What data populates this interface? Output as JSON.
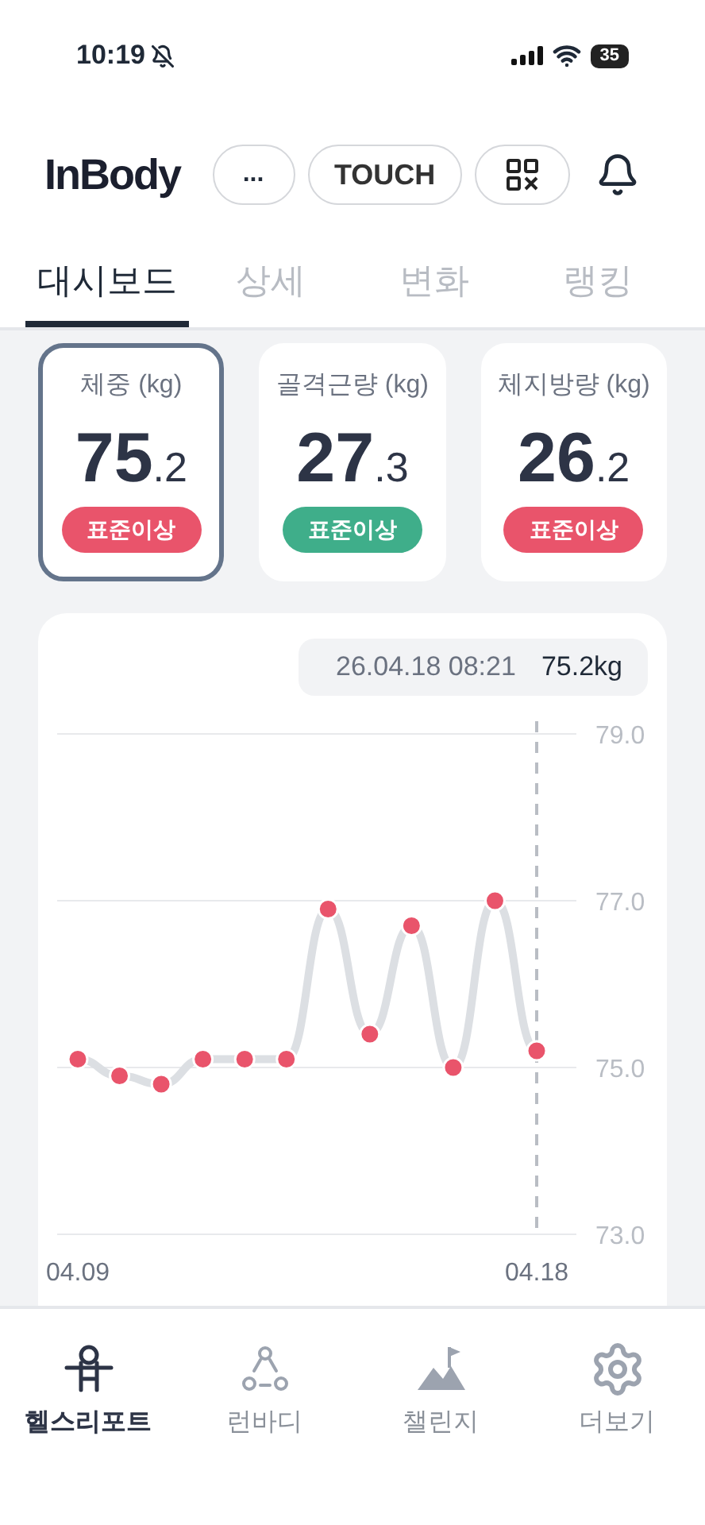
{
  "status_bar": {
    "time": "10:19",
    "battery": "35"
  },
  "header": {
    "logo": "InBody",
    "buttons": [
      {
        "kind": "more",
        "label": "..."
      },
      {
        "kind": "text",
        "label": "TOUCH"
      },
      {
        "kind": "qr"
      }
    ]
  },
  "tabs": [
    {
      "label": "대시보드",
      "selected": true
    },
    {
      "label": "상세",
      "selected": false
    },
    {
      "label": "변화",
      "selected": false
    },
    {
      "label": "랭킹",
      "selected": false
    }
  ],
  "cards": [
    {
      "title": "체중 (kg)",
      "value": "75",
      "decimal": ".2",
      "badge": "표준이상",
      "color": "#e9546b",
      "selected": true
    },
    {
      "title": "골격근량 (kg)",
      "value": "27",
      "decimal": ".3",
      "badge": "표준이상",
      "color": "#3fae8a",
      "selected": false
    },
    {
      "title": "체지방량 (kg)",
      "value": "26",
      "decimal": ".2",
      "badge": "표준이상",
      "color": "#e9546b",
      "selected": false
    }
  ],
  "chart": {
    "tooltip": {
      "date": "26.04.18 08:21",
      "value": "75.2kg"
    },
    "chart_data": {
      "type": "line",
      "categories": [
        "04.09",
        null,
        null,
        null,
        null,
        null,
        null,
        null,
        null,
        null,
        null,
        "04.18"
      ],
      "series": [
        {
          "color": "#e9546b",
          "marker": "circle",
          "values": [
            75.1,
            74.9,
            74.8,
            75.1,
            75.1,
            75.1,
            76.9,
            75.4,
            76.7,
            75.0,
            77.0,
            75.2
          ]
        }
      ],
      "ylim": [
        73,
        79
      ],
      "yticks": [
        {
          "value": 79,
          "label": "79.0"
        },
        {
          "value": 77,
          "label": "77.0"
        },
        {
          "value": 75,
          "label": "75.0"
        },
        {
          "value": 73,
          "label": "73.0"
        }
      ]
    }
  },
  "nav": [
    {
      "kind": "report",
      "label": "헬스리포트",
      "selected": true
    },
    {
      "kind": "run",
      "label": "런바디",
      "selected": false
    },
    {
      "kind": "challenge",
      "label": "챌린지",
      "selected": false
    },
    {
      "kind": "more",
      "label": "더보기",
      "selected": false
    }
  ]
}
